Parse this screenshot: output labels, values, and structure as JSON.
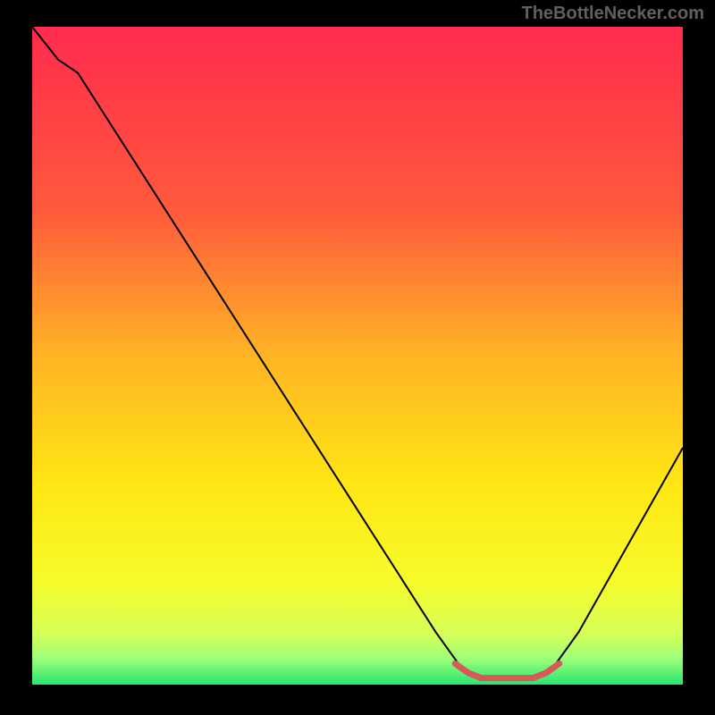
{
  "watermark": "TheBottleNecker.com",
  "chart_data": {
    "type": "line",
    "title": "",
    "xlabel": "",
    "ylabel": "",
    "xlim": [
      0,
      100
    ],
    "ylim": [
      0,
      100
    ],
    "gradient_stops": [
      {
        "offset": 0,
        "color": "#ff2b4e"
      },
      {
        "offset": 28,
        "color": "#ff5a3c"
      },
      {
        "offset": 50,
        "color": "#ffb424"
      },
      {
        "offset": 70,
        "color": "#ffe714"
      },
      {
        "offset": 84,
        "color": "#f7fb2a"
      },
      {
        "offset": 92,
        "color": "#d8ff55"
      },
      {
        "offset": 96,
        "color": "#9fff7a"
      },
      {
        "offset": 100,
        "color": "#28e66f"
      }
    ],
    "series": [
      {
        "name": "curve",
        "color": "#000000",
        "stroke_width": 2,
        "points": [
          {
            "x": 0,
            "y": 100
          },
          {
            "x": 4,
            "y": 95
          },
          {
            "x": 7,
            "y": 93
          },
          {
            "x": 62,
            "y": 8
          },
          {
            "x": 66,
            "y": 2.5
          },
          {
            "x": 69,
            "y": 1.0
          },
          {
            "x": 77,
            "y": 1.0
          },
          {
            "x": 80,
            "y": 2.5
          },
          {
            "x": 84,
            "y": 8
          },
          {
            "x": 100,
            "y": 36
          }
        ]
      },
      {
        "name": "highlight",
        "color": "#d65a5a",
        "stroke_width": 7,
        "points": [
          {
            "x": 65,
            "y": 3.2
          },
          {
            "x": 67,
            "y": 1.8
          },
          {
            "x": 69,
            "y": 1.0
          },
          {
            "x": 77,
            "y": 1.0
          },
          {
            "x": 79,
            "y": 1.8
          },
          {
            "x": 81,
            "y": 3.2
          }
        ]
      }
    ]
  }
}
